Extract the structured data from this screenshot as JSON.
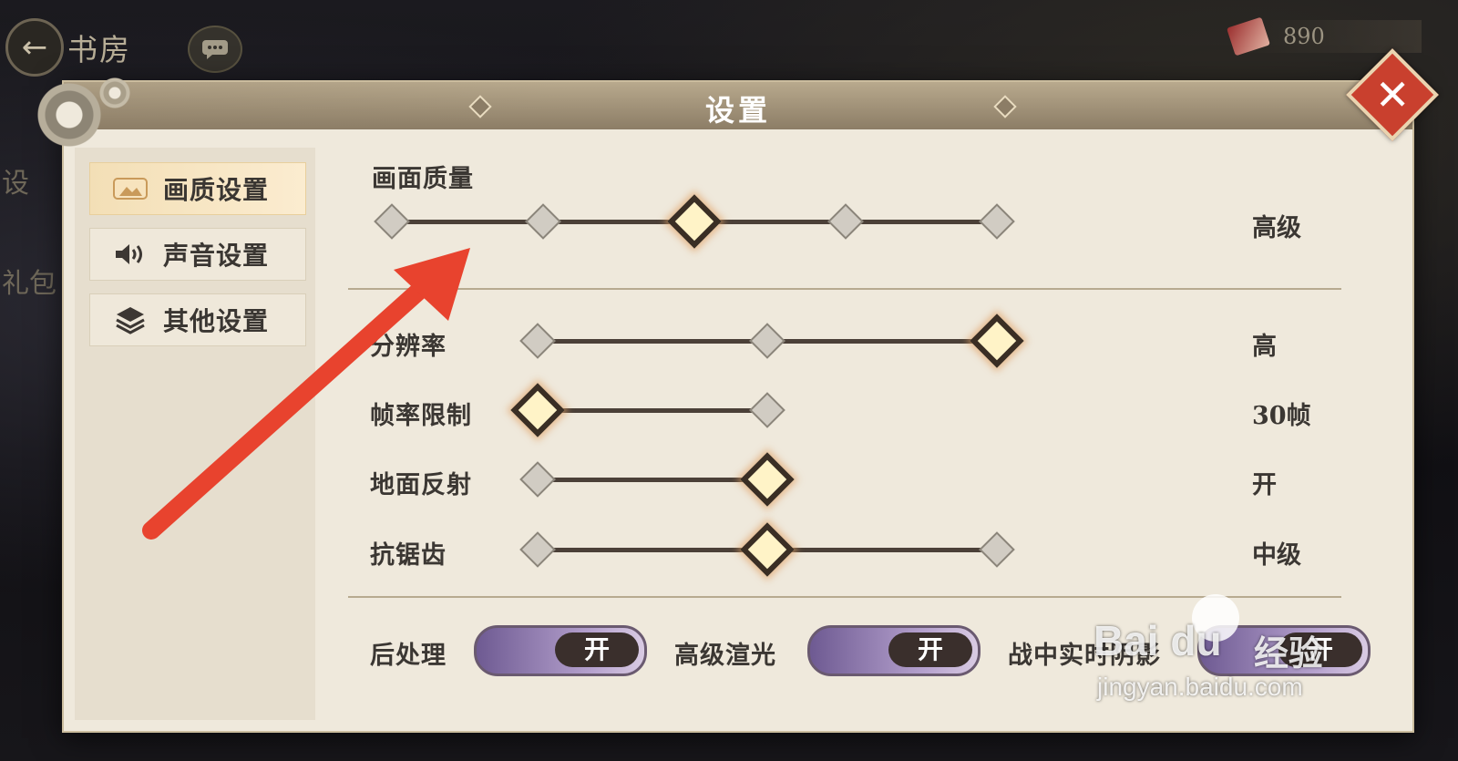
{
  "topbar": {
    "back_glyph": "←",
    "room_title": "书房",
    "chat_glyph": "···",
    "currency_value": "890"
  },
  "side_ghost": {
    "top": "设",
    "middle": "礼包"
  },
  "panel": {
    "title": "设置",
    "close_glyph": "✕"
  },
  "sidebar": {
    "tabs": [
      {
        "label": "画质设置",
        "icon": "image-icon",
        "active": true
      },
      {
        "label": "声音设置",
        "icon": "speaker-icon",
        "active": false
      },
      {
        "label": "其他设置",
        "icon": "layers-icon",
        "active": false
      }
    ]
  },
  "settings": {
    "quality": {
      "label": "画面质量",
      "value": "高级",
      "steps": 5,
      "selected_index": 2
    },
    "resolution": {
      "label": "分辨率",
      "value": "高",
      "steps": 3,
      "selected_index": 2
    },
    "framerate": {
      "label": "帧率限制",
      "value": "30帧",
      "steps": 2,
      "selected_index": 0
    },
    "reflection": {
      "label": "地面反射",
      "value": "开",
      "steps": 2,
      "selected_index": 1
    },
    "antialias": {
      "label": "抗锯齿",
      "value": "中级",
      "steps": 3,
      "selected_index": 1
    },
    "postprocess": {
      "label": "后处理",
      "state": "开"
    },
    "bloom": {
      "label": "高级渲光",
      "state": "开"
    },
    "realtime_shadow": {
      "label": "战中实时阴影",
      "state": "开"
    }
  },
  "watermark": {
    "logo": "Bai du",
    "brand": "经验",
    "url": "jingyan.baidu.com"
  },
  "annotation": {
    "arrow_color": "#e8432e"
  },
  "colors": {
    "accent_active": "#f3dfb6",
    "toggle_purple": "#6e5a92",
    "close_red": "#c9402e"
  }
}
